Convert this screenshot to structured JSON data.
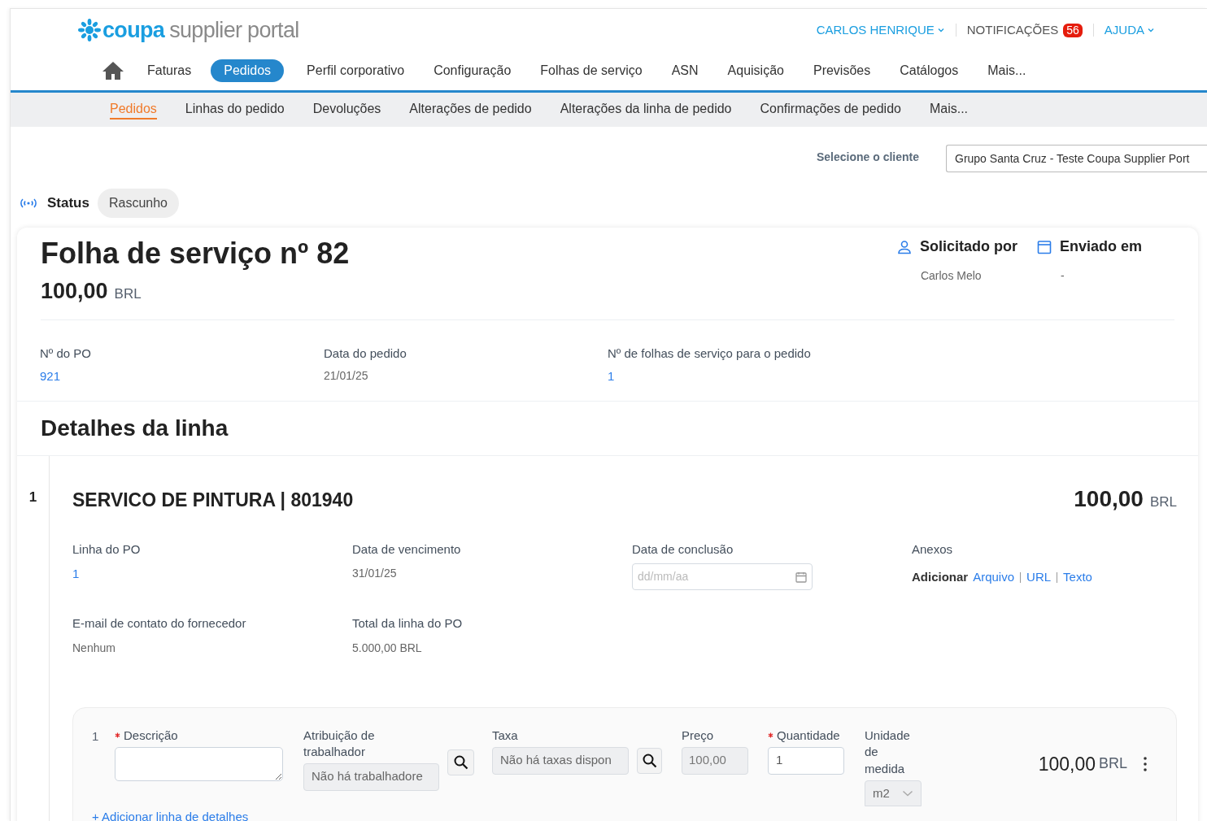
{
  "header": {
    "logo": {
      "brand": "coupa",
      "product": "supplier portal"
    },
    "user_menu": "CARLOS HENRIQUE",
    "notifications": {
      "label": "NOTIFICAÇÕES",
      "count": "56"
    },
    "help": "AJUDA"
  },
  "main_nav": [
    {
      "label": "Faturas",
      "selected": false
    },
    {
      "label": "Pedidos",
      "selected": true
    },
    {
      "label": "Perfil corporativo",
      "selected": false
    },
    {
      "label": "Configuração",
      "selected": false
    },
    {
      "label": "Folhas de serviço",
      "selected": false
    },
    {
      "label": "ASN",
      "selected": false
    },
    {
      "label": "Aquisição",
      "selected": false
    },
    {
      "label": "Previsões",
      "selected": false
    },
    {
      "label": "Catálogos",
      "selected": false
    },
    {
      "label": "Mais...",
      "selected": false
    }
  ],
  "sub_nav": [
    {
      "label": "Pedidos",
      "selected": true
    },
    {
      "label": "Linhas do pedido",
      "selected": false
    },
    {
      "label": "Devoluções",
      "selected": false
    },
    {
      "label": "Alterações de pedido",
      "selected": false
    },
    {
      "label": "Alterações da linha de pedido",
      "selected": false
    },
    {
      "label": "Confirmações de pedido",
      "selected": false
    },
    {
      "label": "Mais...",
      "selected": false
    }
  ],
  "client_select": {
    "label": "Selecione o cliente",
    "value": "Grupo Santa Cruz - Teste Coupa Supplier Port"
  },
  "status": {
    "label": "Status",
    "value": "Rascunho"
  },
  "sheet": {
    "title": "Folha de serviço nº 82",
    "amount": "100,00",
    "currency": "BRL",
    "meta": [
      {
        "kind": "person",
        "label": "Solicitado por",
        "value": "Carlos Melo"
      },
      {
        "kind": "calendar",
        "label": "Enviado em",
        "value": "-"
      }
    ],
    "fields": [
      {
        "kind": "link",
        "label": "Nº do PO",
        "value": "921"
      },
      {
        "kind": "text",
        "label": "Data do pedido",
        "value": "21/01/25"
      },
      {
        "kind": "link",
        "label": "Nº de folhas de serviço para o pedido",
        "value": "1"
      }
    ]
  },
  "line_details": {
    "heading": "Detalhes da linha",
    "lines": [
      {
        "number": "1",
        "title": "SERVICO DE PINTURA | 801940",
        "amount": "100,00",
        "currency": "BRL",
        "fields": [
          {
            "kind": "link",
            "label": "Linha do PO",
            "value": "1"
          },
          {
            "kind": "text",
            "label": "Data de vencimento",
            "value": "31/01/25"
          },
          {
            "kind": "date",
            "label": "Data de conclusão",
            "placeholder": "dd/mm/aa"
          },
          {
            "kind": "attachments",
            "label": "Anexos",
            "prefix": "Adicionar",
            "links": [
              "Arquivo",
              "URL",
              "Texto"
            ]
          },
          {
            "kind": "text",
            "label": "E-mail de contato do fornecedor",
            "value": "Nenhum"
          },
          {
            "kind": "text",
            "label": "Total da linha do PO",
            "value": "5.000,00 BRL"
          }
        ],
        "details": [
          {
            "number": "1",
            "description": {
              "label": "Descrição",
              "required": true
            },
            "worker": {
              "label": "Atribuição de trabalhador",
              "value": "Não há trabalhadore"
            },
            "tax": {
              "label": "Taxa",
              "value": "Não há taxas dispon"
            },
            "price": {
              "label": "Preço",
              "value": "100,00"
            },
            "quantity": {
              "label": "Quantidade",
              "required": true,
              "value": "1"
            },
            "unit": {
              "label": "Unidade de medida",
              "value": "m2"
            },
            "amount": "100,00",
            "currency": "BRL"
          }
        ],
        "add_detail": "+ Adicionar linha de detalhes"
      }
    ]
  }
}
